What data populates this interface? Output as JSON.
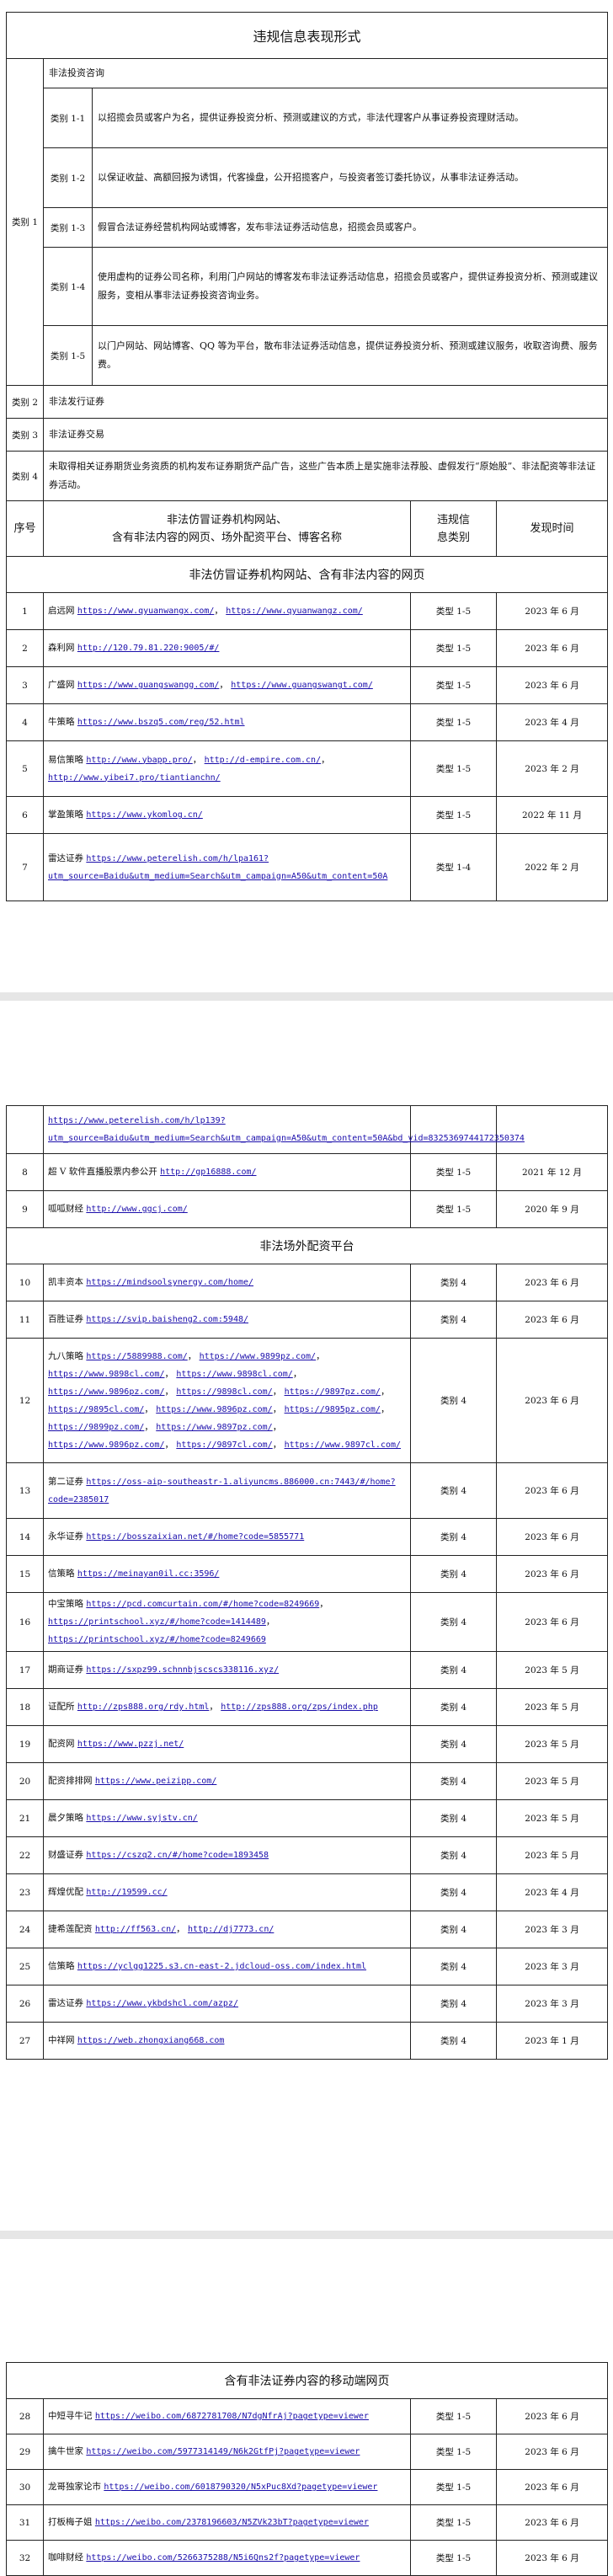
{
  "p1": {
    "title": "违规信息表现形式",
    "cat1": "类别 1",
    "cat1_head": "非法投资咨询",
    "cat1_subs": [
      {
        "label": "类别 1-1",
        "text": "以招揽会员或客户为名，提供证券投资分析、预测或建议的方式，非法代理客户从事证券投资理财活动。"
      },
      {
        "label": "类别 1-2",
        "text": "以保证收益、高额回报为诱饵，代客操盘，公开招揽客户，与投资者签订委托协议，从事非法证券活动。"
      },
      {
        "label": "类别 1-3",
        "text": "假冒合法证券经营机构网站或博客，发布非法证券活动信息，招揽会员或客户。"
      },
      {
        "label": "类别 1-4",
        "text": "使用虚构的证券公司名称，利用门户网站的博客发布非法证券活动信息，招揽会员或客户，提供证券投资分析、预测或建议服务，变相从事非法证券投资咨询业务。"
      },
      {
        "label": "类别 1-5",
        "text": "以门户网站、网站博客、QQ 等为平台，散布非法证券活动信息，提供证券投资分析、预测或建议服务，收取咨询费、服务费。"
      }
    ],
    "cat2": "类别 2",
    "cat2_text": "非法发行证券",
    "cat3": "类别 3",
    "cat3_text": "非法证券交易",
    "cat4": "类别 4",
    "cat4_text": "未取得相关证券期货业务资质的机构发布证券期货产品广告，这些广告本质上是实施非法荐股、虚假发行“原始股”、非法配资等非法证券活动。",
    "col_no": "序号",
    "col_site_l1": "非法仿冒证券机构网站、",
    "col_site_l2": "含有非法内容的网页、场外配资平台、博客名称",
    "col_type_l1": "违规信",
    "col_type_l2": "息类别",
    "col_date": "发现时间",
    "section1": "非法仿冒证券机构网站、含有非法内容的网页",
    "rows": [
      {
        "no": "1",
        "name": "启远网",
        "links": [
          "https://www.qyuanwangx.com/",
          "https://www.qyuanwangz.com/"
        ],
        "type": "类型 1-5",
        "date": "2023 年 6 月"
      },
      {
        "no": "2",
        "name": "森利网",
        "links": [
          "http://120.79.81.220:9005/#/"
        ],
        "type": "类型 1-5",
        "date": "2023 年 6 月"
      },
      {
        "no": "3",
        "name": "广盛网",
        "links": [
          "https://www.guangswangg.com/",
          "https://www.guangswangt.com/"
        ],
        "type": "类型 1-5",
        "date": "2023 年 6 月"
      },
      {
        "no": "4",
        "name": "牛策略",
        "links": [
          "https://www.bszq5.com/reg/52.html"
        ],
        "type": "类型 1-5",
        "date": "2023 年 4 月"
      },
      {
        "no": "5",
        "name": "易信策略",
        "links": [
          "http://www.ybapp.pro/",
          "http://d-empire.com.cn/",
          "http://www.yibei7.pro/tiantianchn/"
        ],
        "type": "类型 1-5",
        "date": "2023 年 2 月"
      },
      {
        "no": "6",
        "name": "掌盈策略",
        "links": [
          "https://www.ykomlog.cn/"
        ],
        "type": "类型 1-5",
        "date": "2022 年 11 月"
      },
      {
        "no": "7",
        "name": "雷达证券",
        "links": [
          "https://www.peterelish.com/h/lpa161?utm_source=Baidu&utm_medium=Search&utm_campaign=A50&utm_content=50A"
        ],
        "type": "类型 1-4",
        "date": "2022 年 2 月"
      }
    ]
  },
  "p2": {
    "cont_link": "https://www.peterelish.com/h/lp139?utm_source=Baidu&utm_medium=Search&utm_campaign=A50&utm_content=50A&bd_vid=8325369744172350374",
    "rows_a": [
      {
        "no": "8",
        "name": "超 V 软件直播股票内参公开",
        "links": [
          "http://gp16888.com/"
        ],
        "type": "类型 1-5",
        "date": "2021 年 12 月"
      },
      {
        "no": "9",
        "name": "呱呱财经",
        "links": [
          "http://www.ggcj.com/"
        ],
        "type": "类型 1-5",
        "date": "2020 年 9 月"
      }
    ],
    "section2": "非法场外配资平台",
    "rows_b": [
      {
        "no": "10",
        "name": "凯丰资本",
        "links": [
          "https://mindsoolsynergy.com/home/"
        ],
        "type": "类别 4",
        "date": "2023 年 6 月"
      },
      {
        "no": "11",
        "name": "百胜证券",
        "links": [
          "https://svip.baisheng2.com:5948/"
        ],
        "type": "类别 4",
        "date": "2023 年 6 月"
      },
      {
        "no": "12",
        "name": "九八策略",
        "links": [
          "https://5889988.com/",
          "https://www.9899pz.com/",
          "https://www.9898cl.com/",
          "https://www.9898cl.com/",
          "https://www.9896pz.com/",
          "https://9898cl.com/",
          "https://9897pz.com/",
          "https://9895cl.com/",
          "https://www.9896pz.com/",
          "https://9895pz.com/",
          "https://9899pz.com/",
          "https://www.9897pz.com/",
          "https://www.9896pz.com/",
          "https://9897cl.com/",
          "https://www.9897cl.com/"
        ],
        "type": "类别 4",
        "date": "2023 年 6 月"
      },
      {
        "no": "13",
        "name": "第二证券",
        "links": [
          "https://oss-aip-southeastr-1.aliyuncms.886000.cn:7443/#/home?code=2385017"
        ],
        "type": "类别 4",
        "date": "2023 年 6 月"
      },
      {
        "no": "14",
        "name": "永华证券",
        "links": [
          "https://bosszaixian.net/#/home?code=5855771"
        ],
        "type": "类别 4",
        "date": "2023 年 6 月"
      },
      {
        "no": "15",
        "name": "信策略",
        "links": [
          "https://meinayan0il.cc:3596/"
        ],
        "type": "类别 4",
        "date": "2023 年 6 月"
      },
      {
        "no": "16",
        "name": "中宝策略",
        "links": [
          "https://pcd.comcurtain.com/#/home?code=8249669",
          "https://printschool.xyz/#/home?code=1414489",
          "https://printschool.xyz/#/home?code=8249669"
        ],
        "type": "类别 4",
        "date": "2023 年 6 月"
      },
      {
        "no": "17",
        "name": "期商证券",
        "links": [
          "https://sxpz99.schnnbjscscs338116.xyz/"
        ],
        "type": "类别 4",
        "date": "2023 年 5 月"
      },
      {
        "no": "18",
        "name": "证配所",
        "links": [
          "http://zps888.org/rdy.html",
          "http://zps888.org/zps/index.php"
        ],
        "type": "类别 4",
        "date": "2023 年 5 月"
      },
      {
        "no": "19",
        "name": "配资网",
        "links": [
          "https://www.pzzj.net/"
        ],
        "type": "类别 4",
        "date": "2023 年 5 月"
      },
      {
        "no": "20",
        "name": "配资排排网",
        "links": [
          "https://www.peizipp.com/"
        ],
        "type": "类别 4",
        "date": "2023 年 5 月"
      },
      {
        "no": "21",
        "name": "晨夕策略",
        "links": [
          "https://www.syjstv.cn/"
        ],
        "type": "类别 4",
        "date": "2023 年 5 月"
      },
      {
        "no": "22",
        "name": "财盛证券",
        "links": [
          "https://cszq2.cn/#/home?code=1893458"
        ],
        "type": "类别 4",
        "date": "2023 年 5 月"
      },
      {
        "no": "23",
        "name": "辉煌优配",
        "links": [
          "http://19599.cc/"
        ],
        "type": "类别 4",
        "date": "2023 年 4 月"
      },
      {
        "no": "24",
        "name": "捷希莲配资",
        "links": [
          "http://ff563.cn/",
          "http://dj7773.cn/"
        ],
        "type": "类别 4",
        "date": "2023 年 3 月"
      },
      {
        "no": "25",
        "name": "信策略",
        "links": [
          "https://yclgg1225.s3.cn-east-2.jdcloud-oss.com/index.html"
        ],
        "type": "类别 4",
        "date": "2023 年 3 月"
      },
      {
        "no": "26",
        "name": "雷达证券",
        "links": [
          "https://www.ykbdshcl.com/azpz/"
        ],
        "type": "类别 4",
        "date": "2023 年 3 月"
      },
      {
        "no": "27",
        "name": "中祥网",
        "links": [
          "https://web.zhongxiang668.com"
        ],
        "type": "类别 4",
        "date": "2023 年 1 月"
      }
    ]
  },
  "p3": {
    "section3": "含有非法证券内容的移动端网页",
    "rows": [
      {
        "no": "28",
        "name": "中短寻牛记",
        "links": [
          "https://weibo.com/6872781708/N7dgNfrAj?pagetype=viewer"
        ],
        "type": "类型 1-5",
        "date": "2023 年 6 月"
      },
      {
        "no": "29",
        "name": "擒牛世家",
        "links": [
          "https://weibo.com/5977314149/N6k2GtfPj?pagetype=viewer"
        ],
        "type": "类型 1-5",
        "date": "2023 年 6 月"
      },
      {
        "no": "30",
        "name": "龙哥独家论市",
        "links": [
          "https://weibo.com/6018790320/N5xPuc8Xd?pagetype=viewer"
        ],
        "type": "类型 1-5",
        "date": "2023 年 6 月"
      },
      {
        "no": "31",
        "name": "打板梅子姐",
        "links": [
          "https://weibo.com/2378196603/N5ZVk23bT?pagetype=viewer"
        ],
        "type": "类型 1-5",
        "date": "2023 年 6 月"
      },
      {
        "no": "32",
        "name": "咖啡财经",
        "links": [
          "https://weibo.com/5266375288/N5i6Qns2f?pagetype=viewer"
        ],
        "type": "类型 1-5",
        "date": "2023 年 6 月"
      }
    ]
  }
}
